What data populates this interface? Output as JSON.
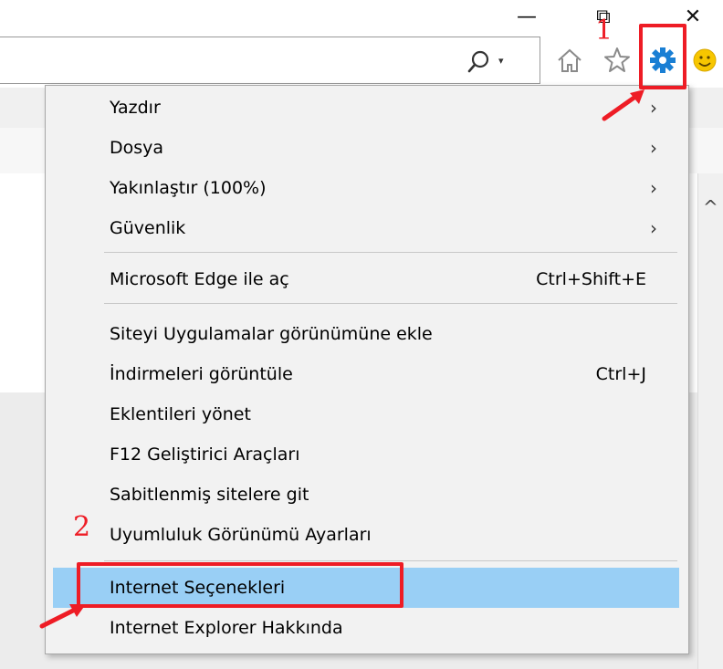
{
  "window": {
    "minimize_glyph": "—",
    "restore_glyph": "⧉",
    "close_glyph": "✕"
  },
  "toolbar": {
    "dropdown_glyph": "▾",
    "icons": [
      "search-icon",
      "home-icon",
      "favorites-star-icon",
      "tools-gear-icon",
      "feedback-smiley-icon"
    ]
  },
  "menu": {
    "items": [
      {
        "label": "Yazdır",
        "has_submenu": true
      },
      {
        "label": "Dosya",
        "has_submenu": true
      },
      {
        "label": "Yakınlaştır (100%)",
        "has_submenu": true
      },
      {
        "label": "Güvenlik",
        "has_submenu": true
      },
      {
        "label": "Microsoft Edge ile aç",
        "shortcut": "Ctrl+Shift+E"
      },
      {
        "label": "Siteyi Uygulamalar görünümüne ekle"
      },
      {
        "label": "İndirmeleri görüntüle",
        "shortcut": "Ctrl+J"
      },
      {
        "label": "Eklentileri yönet"
      },
      {
        "label": "F12 Geliştirici Araçları"
      },
      {
        "label": "Sabitlenmiş sitelere git"
      },
      {
        "label": "Uyumluluk Görünümü Ayarları"
      },
      {
        "label": "Internet Seçenekleri",
        "highlighted": true
      },
      {
        "label": "Internet Explorer Hakkında"
      }
    ],
    "submenu_arrow": "›"
  },
  "annotations": {
    "step1": "1",
    "step2": "2",
    "color": "#ee1c25"
  },
  "colors": {
    "highlight": "#99cff5",
    "gear": "#1a7fd4"
  }
}
